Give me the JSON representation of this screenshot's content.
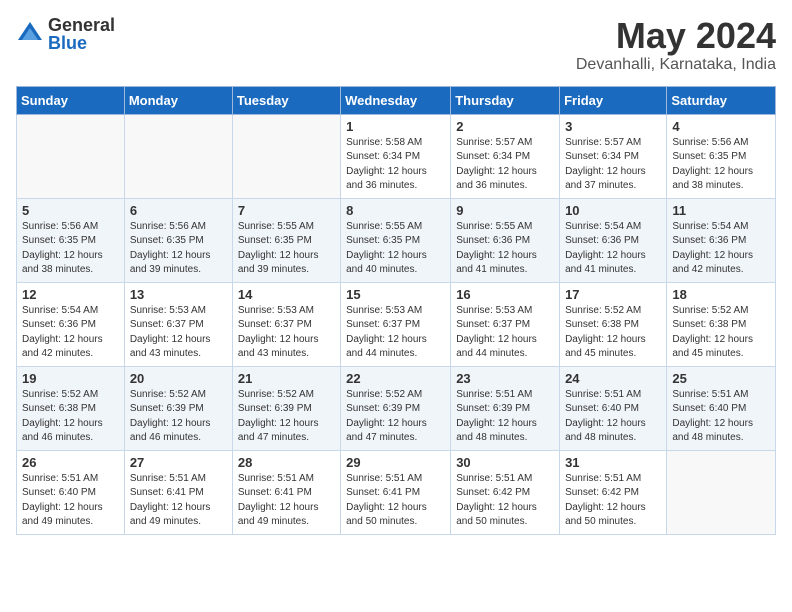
{
  "logo": {
    "general": "General",
    "blue": "Blue"
  },
  "title": "May 2024",
  "subtitle": "Devanhalli, Karnataka, India",
  "headers": [
    "Sunday",
    "Monday",
    "Tuesday",
    "Wednesday",
    "Thursday",
    "Friday",
    "Saturday"
  ],
  "weeks": [
    [
      {
        "day": "",
        "info": ""
      },
      {
        "day": "",
        "info": ""
      },
      {
        "day": "",
        "info": ""
      },
      {
        "day": "1",
        "info": "Sunrise: 5:58 AM\nSunset: 6:34 PM\nDaylight: 12 hours\nand 36 minutes."
      },
      {
        "day": "2",
        "info": "Sunrise: 5:57 AM\nSunset: 6:34 PM\nDaylight: 12 hours\nand 36 minutes."
      },
      {
        "day": "3",
        "info": "Sunrise: 5:57 AM\nSunset: 6:34 PM\nDaylight: 12 hours\nand 37 minutes."
      },
      {
        "day": "4",
        "info": "Sunrise: 5:56 AM\nSunset: 6:35 PM\nDaylight: 12 hours\nand 38 minutes."
      }
    ],
    [
      {
        "day": "5",
        "info": "Sunrise: 5:56 AM\nSunset: 6:35 PM\nDaylight: 12 hours\nand 38 minutes."
      },
      {
        "day": "6",
        "info": "Sunrise: 5:56 AM\nSunset: 6:35 PM\nDaylight: 12 hours\nand 39 minutes."
      },
      {
        "day": "7",
        "info": "Sunrise: 5:55 AM\nSunset: 6:35 PM\nDaylight: 12 hours\nand 39 minutes."
      },
      {
        "day": "8",
        "info": "Sunrise: 5:55 AM\nSunset: 6:35 PM\nDaylight: 12 hours\nand 40 minutes."
      },
      {
        "day": "9",
        "info": "Sunrise: 5:55 AM\nSunset: 6:36 PM\nDaylight: 12 hours\nand 41 minutes."
      },
      {
        "day": "10",
        "info": "Sunrise: 5:54 AM\nSunset: 6:36 PM\nDaylight: 12 hours\nand 41 minutes."
      },
      {
        "day": "11",
        "info": "Sunrise: 5:54 AM\nSunset: 6:36 PM\nDaylight: 12 hours\nand 42 minutes."
      }
    ],
    [
      {
        "day": "12",
        "info": "Sunrise: 5:54 AM\nSunset: 6:36 PM\nDaylight: 12 hours\nand 42 minutes."
      },
      {
        "day": "13",
        "info": "Sunrise: 5:53 AM\nSunset: 6:37 PM\nDaylight: 12 hours\nand 43 minutes."
      },
      {
        "day": "14",
        "info": "Sunrise: 5:53 AM\nSunset: 6:37 PM\nDaylight: 12 hours\nand 43 minutes."
      },
      {
        "day": "15",
        "info": "Sunrise: 5:53 AM\nSunset: 6:37 PM\nDaylight: 12 hours\nand 44 minutes."
      },
      {
        "day": "16",
        "info": "Sunrise: 5:53 AM\nSunset: 6:37 PM\nDaylight: 12 hours\nand 44 minutes."
      },
      {
        "day": "17",
        "info": "Sunrise: 5:52 AM\nSunset: 6:38 PM\nDaylight: 12 hours\nand 45 minutes."
      },
      {
        "day": "18",
        "info": "Sunrise: 5:52 AM\nSunset: 6:38 PM\nDaylight: 12 hours\nand 45 minutes."
      }
    ],
    [
      {
        "day": "19",
        "info": "Sunrise: 5:52 AM\nSunset: 6:38 PM\nDaylight: 12 hours\nand 46 minutes."
      },
      {
        "day": "20",
        "info": "Sunrise: 5:52 AM\nSunset: 6:39 PM\nDaylight: 12 hours\nand 46 minutes."
      },
      {
        "day": "21",
        "info": "Sunrise: 5:52 AM\nSunset: 6:39 PM\nDaylight: 12 hours\nand 47 minutes."
      },
      {
        "day": "22",
        "info": "Sunrise: 5:52 AM\nSunset: 6:39 PM\nDaylight: 12 hours\nand 47 minutes."
      },
      {
        "day": "23",
        "info": "Sunrise: 5:51 AM\nSunset: 6:39 PM\nDaylight: 12 hours\nand 48 minutes."
      },
      {
        "day": "24",
        "info": "Sunrise: 5:51 AM\nSunset: 6:40 PM\nDaylight: 12 hours\nand 48 minutes."
      },
      {
        "day": "25",
        "info": "Sunrise: 5:51 AM\nSunset: 6:40 PM\nDaylight: 12 hours\nand 48 minutes."
      }
    ],
    [
      {
        "day": "26",
        "info": "Sunrise: 5:51 AM\nSunset: 6:40 PM\nDaylight: 12 hours\nand 49 minutes."
      },
      {
        "day": "27",
        "info": "Sunrise: 5:51 AM\nSunset: 6:41 PM\nDaylight: 12 hours\nand 49 minutes."
      },
      {
        "day": "28",
        "info": "Sunrise: 5:51 AM\nSunset: 6:41 PM\nDaylight: 12 hours\nand 49 minutes."
      },
      {
        "day": "29",
        "info": "Sunrise: 5:51 AM\nSunset: 6:41 PM\nDaylight: 12 hours\nand 50 minutes."
      },
      {
        "day": "30",
        "info": "Sunrise: 5:51 AM\nSunset: 6:42 PM\nDaylight: 12 hours\nand 50 minutes."
      },
      {
        "day": "31",
        "info": "Sunrise: 5:51 AM\nSunset: 6:42 PM\nDaylight: 12 hours\nand 50 minutes."
      },
      {
        "day": "",
        "info": ""
      }
    ]
  ]
}
